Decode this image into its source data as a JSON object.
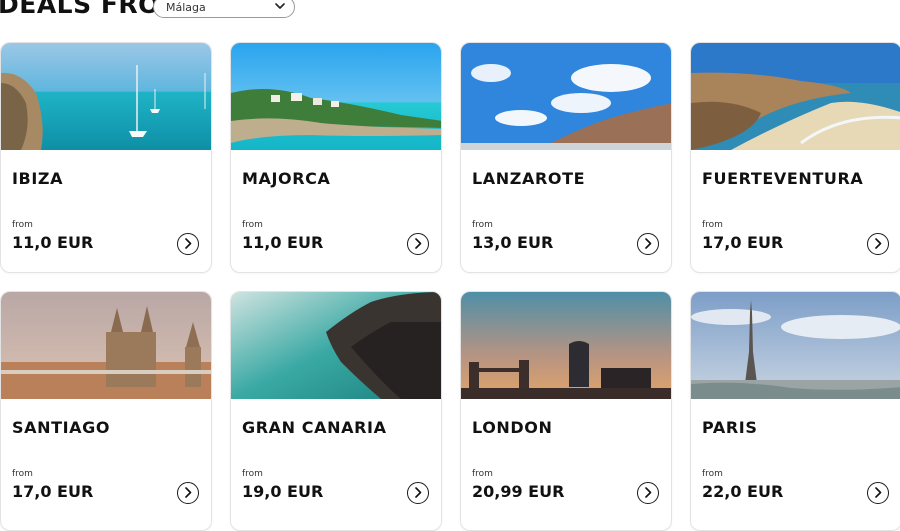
{
  "header": {
    "title": "DEALS FROM",
    "origin_select": {
      "value": "Málaga",
      "icon": "chevron-down-icon"
    }
  },
  "deals": [
    {
      "name": "IBIZA",
      "from_label": "from",
      "price": "11,0 EUR",
      "icon": "arrow-right-circle-icon"
    },
    {
      "name": "MAJORCA",
      "from_label": "from",
      "price": "11,0 EUR",
      "icon": "arrow-right-circle-icon"
    },
    {
      "name": "LANZAROTE",
      "from_label": "from",
      "price": "13,0 EUR",
      "icon": "arrow-right-circle-icon"
    },
    {
      "name": "FUERTEVENTURA",
      "from_label": "from",
      "price": "17,0 EUR",
      "icon": "arrow-right-circle-icon"
    },
    {
      "name": "SANTIAGO",
      "from_label": "from",
      "price": "17,0 EUR",
      "icon": "arrow-right-circle-icon"
    },
    {
      "name": "GRAN CANARIA",
      "from_label": "from",
      "price": "19,0 EUR",
      "icon": "arrow-right-circle-icon"
    },
    {
      "name": "LONDON",
      "from_label": "from",
      "price": "20,99 EUR",
      "icon": "arrow-right-circle-icon"
    },
    {
      "name": "PARIS",
      "from_label": "from",
      "price": "22,0 EUR",
      "icon": "arrow-right-circle-icon"
    }
  ]
}
